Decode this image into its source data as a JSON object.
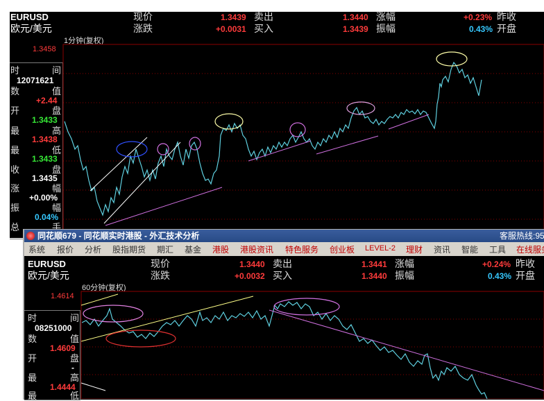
{
  "top": {
    "symbol": "EURUSD",
    "name": "欧元/美元",
    "interval_label": "1分钟(复权)",
    "quote": {
      "price_label": "现价",
      "price": "1.3439",
      "ask_label": "卖出",
      "ask": "1.3440",
      "change_pct_label": "涨幅",
      "change_pct": "+0.23%",
      "prev_close_label": "昨收",
      "change_label": "涨跌",
      "change": "+0.0031",
      "bid_label": "买入",
      "bid": "1.3439",
      "amplitude_label": "振幅",
      "amplitude": "0.43%",
      "open_label": "开盘"
    },
    "axis_top": "1.3458",
    "info": {
      "time_a": "时",
      "time_b": "间",
      "time_value": "12071621",
      "value_a": "数",
      "value_b": "值",
      "value_value": "+2.44",
      "open_a": "开",
      "open_b": "盘",
      "open_value": "1.3433",
      "high_a": "最",
      "high_b": "高",
      "high_value": "1.3438",
      "low_a": "最",
      "low_b": "低",
      "low_value": "1.3433",
      "close_a": "收",
      "close_b": "盘",
      "close_value": "1.3435",
      "chg_a": "涨",
      "chg_b": "幅",
      "chg_value": "+0.00%",
      "amp_a": "振",
      "amp_b": "幅",
      "amp_value": "0.04%",
      "total_a": "总",
      "total_b": "手"
    }
  },
  "bottom": {
    "window_title": "同花顺679 - 同花顺实时港股 - 外汇技术分析",
    "hotline": "客服热线:95",
    "menu": [
      "系统",
      "报价",
      "分析",
      "股指期货",
      "期汇",
      "基金",
      "港股",
      "港股资讯",
      "特色服务",
      "创业板",
      "LEVEL-2",
      "理财",
      "资讯",
      "智能",
      "工具",
      "在线服务"
    ],
    "symbol": "EURUSD",
    "name": "欧元/美元",
    "interval_label": "60分钟(复权)",
    "quote": {
      "price_label": "现价",
      "price": "1.3440",
      "ask_label": "卖出",
      "ask": "1.3441",
      "change_pct_label": "涨幅",
      "change_pct": "+0.24%",
      "prev_close_label": "昨收",
      "change_label": "涨跌",
      "change": "+0.0032",
      "bid_label": "买入",
      "bid": "1.3440",
      "amplitude_label": "振幅",
      "amplitude": "0.43%",
      "open_label": "开盘"
    },
    "axis_top": "1.4614",
    "info": {
      "time_a": "时",
      "time_b": "间",
      "time_value": "08251000",
      "value_a": "数",
      "value_b": "值",
      "value_value": "1.4609",
      "open_a": "开",
      "open_b": "盘",
      "open_value": "-",
      "high_a": "最",
      "high_b": "高",
      "high_value": "1.4444",
      "low_a": "最",
      "low_b": "低"
    }
  },
  "colors": {
    "bg": "#000000",
    "price_line": "#5fd0e0",
    "up": "#ff3b3b",
    "down": "#36e836",
    "flat": "#36c8ff",
    "grid": "#8b0000"
  }
}
